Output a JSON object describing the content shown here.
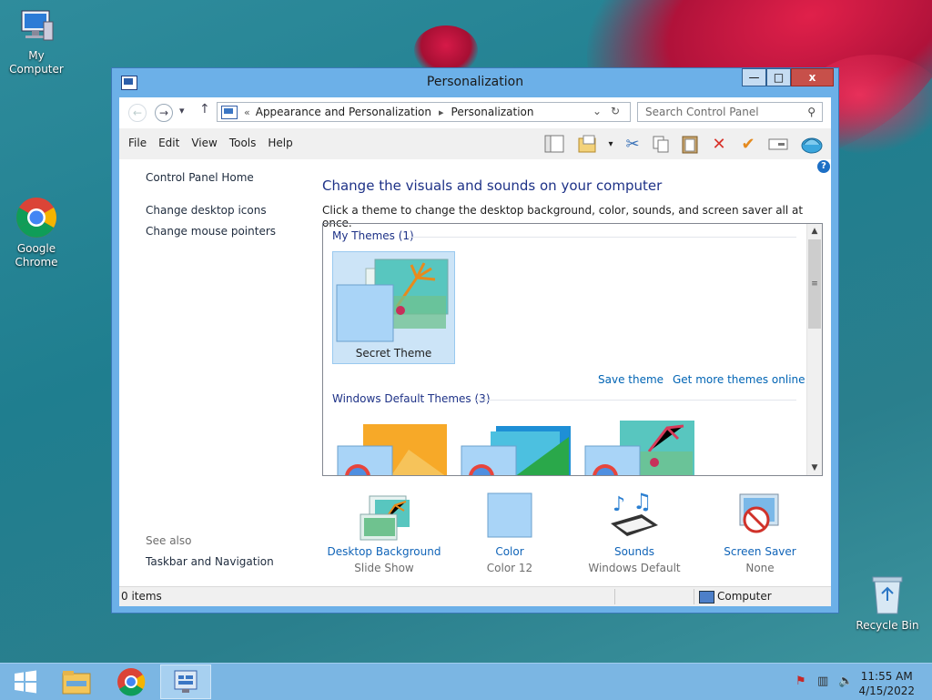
{
  "desktop": {
    "icons": [
      {
        "label": "My Computer"
      },
      {
        "label": "Google Chrome"
      },
      {
        "label": "Recycle Bin"
      }
    ]
  },
  "window": {
    "title": "Personalization",
    "controls": {
      "minimize": "—",
      "maximize": "□",
      "close": "x"
    }
  },
  "address": {
    "overflow": "«",
    "crumbs": [
      "Appearance and Personalization",
      "Personalization"
    ],
    "search_placeholder": "Search Control Panel"
  },
  "menu": [
    "File",
    "Edit",
    "View",
    "Tools",
    "Help"
  ],
  "sidebar": {
    "links": [
      "Control Panel Home",
      "Change desktop icons",
      "Change mouse pointers"
    ],
    "see_also_label": "See also",
    "see_also_links": [
      "Taskbar and Navigation"
    ]
  },
  "main": {
    "heading": "Change the visuals and sounds on your computer",
    "subtext": "Click a theme to change the desktop background, color, sounds, and screen saver all at once.",
    "my_themes_header": "My Themes (1)",
    "selected_theme": "Secret Theme",
    "save_theme": "Save theme",
    "get_more": "Get more themes online",
    "default_themes_header": "Windows Default Themes (3)"
  },
  "settings": [
    {
      "label": "Desktop Background",
      "value": "Slide Show"
    },
    {
      "label": "Color",
      "value": "Color 12"
    },
    {
      "label": "Sounds",
      "value": "Windows Default"
    },
    {
      "label": "Screen Saver",
      "value": "None"
    }
  ],
  "statusbar": {
    "items": "0 items",
    "location": "Computer"
  },
  "taskbar": {
    "time": "11:55 AM",
    "date": "4/15/2022"
  },
  "colors": {
    "title_blue": "#6cb0e8",
    "link_blue": "#0064b4",
    "heading_blue": "#1e3287",
    "close_red": "#c7504a",
    "taskbar": "#7bb6e3"
  }
}
